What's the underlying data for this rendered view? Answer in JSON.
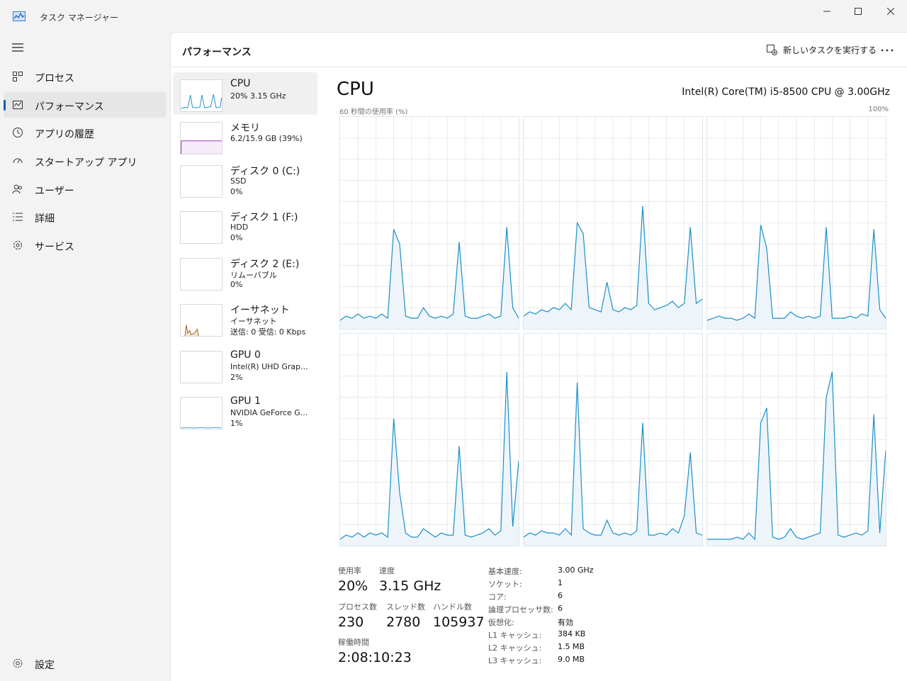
{
  "window": {
    "title": "タスク マネージャー"
  },
  "nav": {
    "items": [
      {
        "label": "プロセス",
        "icon": "process-icon"
      },
      {
        "label": "パフォーマンス",
        "icon": "performance-icon"
      },
      {
        "label": "アプリの履歴",
        "icon": "history-icon"
      },
      {
        "label": "スタートアップ アプリ",
        "icon": "startup-icon"
      },
      {
        "label": "ユーザー",
        "icon": "users-icon"
      },
      {
        "label": "詳細",
        "icon": "details-icon"
      },
      {
        "label": "サービス",
        "icon": "services-icon"
      }
    ],
    "settings_label": "設定",
    "active_index": 1
  },
  "header": {
    "title": "パフォーマンス",
    "run_task_label": "新しいタスクを実行する",
    "more_label": "…"
  },
  "resources": [
    {
      "name": "CPU",
      "line1": "20%  3.15 GHz",
      "line2": ""
    },
    {
      "name": "メモリ",
      "line1": "6.2/15.9 GB (39%)",
      "line2": ""
    },
    {
      "name": "ディスク 0 (C:)",
      "line1": "SSD",
      "line2": "0%"
    },
    {
      "name": "ディスク 1 (F:)",
      "line1": "HDD",
      "line2": "0%"
    },
    {
      "name": "ディスク 2 (E:)",
      "line1": "リムーバブル",
      "line2": "0%"
    },
    {
      "name": "イーサネット",
      "line1": "イーサネット",
      "line2": "送信: 0 受信: 0 Kbps"
    },
    {
      "name": "GPU 0",
      "line1": "Intel(R) UHD Grap...",
      "line2": "2%"
    },
    {
      "name": "GPU 1",
      "line1": "NVIDIA GeForce G...",
      "line2": "1%"
    }
  ],
  "detail": {
    "title": "CPU",
    "model": "Intel(R) Core(TM) i5-8500 CPU @ 3.00GHz",
    "axis_left": "60 秒間の使用率 (%)",
    "axis_right": "100%",
    "stats": {
      "usage_label": "使用率",
      "usage_value": "20%",
      "speed_label": "速度",
      "speed_value": "3.15 GHz",
      "processes_label": "プロセス数",
      "processes_value": "230",
      "threads_label": "スレッド数",
      "threads_value": "2780",
      "handles_label": "ハンドル数",
      "handles_value": "105937",
      "uptime_label": "稼働時間",
      "uptime_value": "2:08:10:23"
    },
    "specs": [
      {
        "label": "基本速度:",
        "value": "3.00 GHz"
      },
      {
        "label": "ソケット:",
        "value": "1"
      },
      {
        "label": "コア:",
        "value": "6"
      },
      {
        "label": "論理プロセッサ数:",
        "value": "6"
      },
      {
        "label": "仮想化:",
        "value": "有効"
      },
      {
        "label": "L1 キャッシュ:",
        "value": "384 KB"
      },
      {
        "label": "L2 キャッシュ:",
        "value": "1.5 MB"
      },
      {
        "label": "L3 キャッシュ:",
        "value": "9.0 MB"
      }
    ]
  },
  "colors": {
    "accent": "#005fb8",
    "cpu_line": "#1a8fca",
    "cpu_fill": "#eef5fa",
    "memory_line": "#8b22a8",
    "network_line": "#a0621c",
    "grid": "#dcdcdc"
  },
  "chart_data": {
    "type": "line",
    "title": "CPU",
    "ylabel": "60 秒間の使用率 (%)",
    "ylim": [
      0,
      100
    ],
    "x": [
      0,
      2,
      4,
      6,
      8,
      10,
      12,
      14,
      16,
      18,
      20,
      22,
      24,
      26,
      28,
      30,
      32,
      34,
      36,
      38,
      40,
      42,
      44,
      46,
      48,
      50,
      52,
      54,
      56,
      58,
      60
    ],
    "series": [
      {
        "values": [
          4,
          6,
          5,
          7,
          5,
          6,
          5,
          7,
          5,
          47,
          40,
          6,
          5,
          5,
          10,
          6,
          5,
          6,
          5,
          7,
          41,
          6,
          5,
          5,
          6,
          7,
          5,
          6,
          48,
          10,
          5
        ]
      },
      {
        "values": [
          6,
          8,
          7,
          9,
          8,
          10,
          9,
          12,
          9,
          50,
          45,
          10,
          9,
          8,
          22,
          9,
          8,
          10,
          9,
          11,
          58,
          12,
          9,
          10,
          11,
          13,
          10,
          12,
          48,
          12,
          14
        ]
      },
      {
        "values": [
          4,
          5,
          6,
          5,
          5,
          4,
          5,
          7,
          5,
          49,
          38,
          5,
          5,
          5,
          8,
          6,
          5,
          6,
          5,
          6,
          48,
          5,
          5,
          5,
          6,
          5,
          7,
          6,
          47,
          9,
          5
        ]
      },
      {
        "values": [
          3,
          5,
          4,
          6,
          4,
          6,
          5,
          6,
          4,
          60,
          25,
          6,
          4,
          4,
          8,
          6,
          4,
          6,
          5,
          5,
          47,
          5,
          4,
          5,
          6,
          8,
          5,
          7,
          82,
          9,
          40
        ]
      },
      {
        "values": [
          4,
          6,
          5,
          7,
          6,
          6,
          5,
          8,
          5,
          77,
          8,
          6,
          5,
          5,
          12,
          6,
          5,
          6,
          5,
          7,
          58,
          5,
          5,
          6,
          5,
          8,
          6,
          14,
          44,
          6,
          5
        ]
      },
      {
        "values": [
          3,
          3,
          3,
          3,
          3,
          4,
          3,
          6,
          3,
          58,
          65,
          4,
          3,
          4,
          8,
          4,
          3,
          4,
          5,
          6,
          70,
          82,
          5,
          4,
          5,
          6,
          5,
          7,
          62,
          6,
          45
        ]
      }
    ]
  }
}
